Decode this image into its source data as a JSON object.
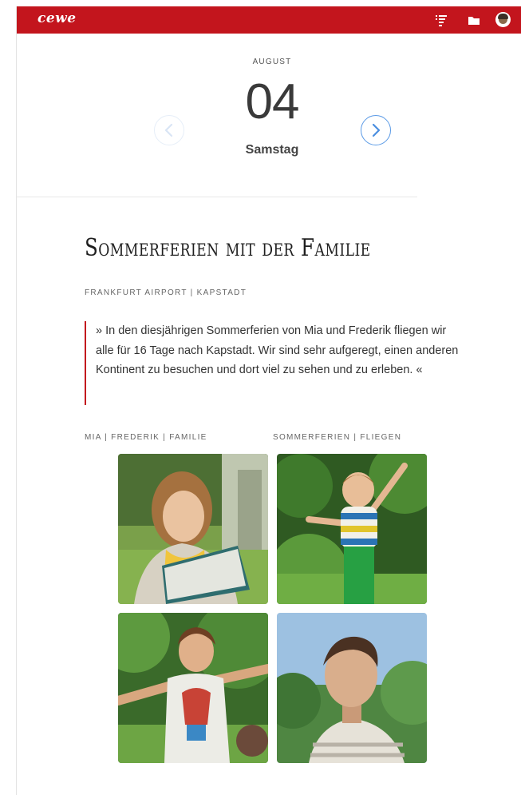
{
  "header": {
    "logo": "cewe",
    "icons": [
      "filter-list-icon",
      "folder-icon",
      "user-avatar"
    ]
  },
  "date": {
    "month": "AUGUST",
    "day": "04",
    "weekday": "Samstag"
  },
  "entry": {
    "title": "Sommerferien mit der Familie",
    "location": "FRANKFURT AIRPORT | KAPSTADT",
    "quote": "» In den diesjährigen Sommerferien von Mia und Frederik fliegen wir alle für 16 Tage nach Kapstadt. Wir sind sehr aufgeregt, einen anderen Kontinent zu besuchen und dort viel zu sehen und zu erleben. «",
    "tags_people": "MIA | FREDERIK | FAMILIE",
    "tags_topics": "SOMMERFERIEN | FLIEGEN"
  },
  "colors": {
    "brand": "#c3151d",
    "nav_next": "#5a9ae6",
    "nav_prev": "#e6eef8"
  }
}
